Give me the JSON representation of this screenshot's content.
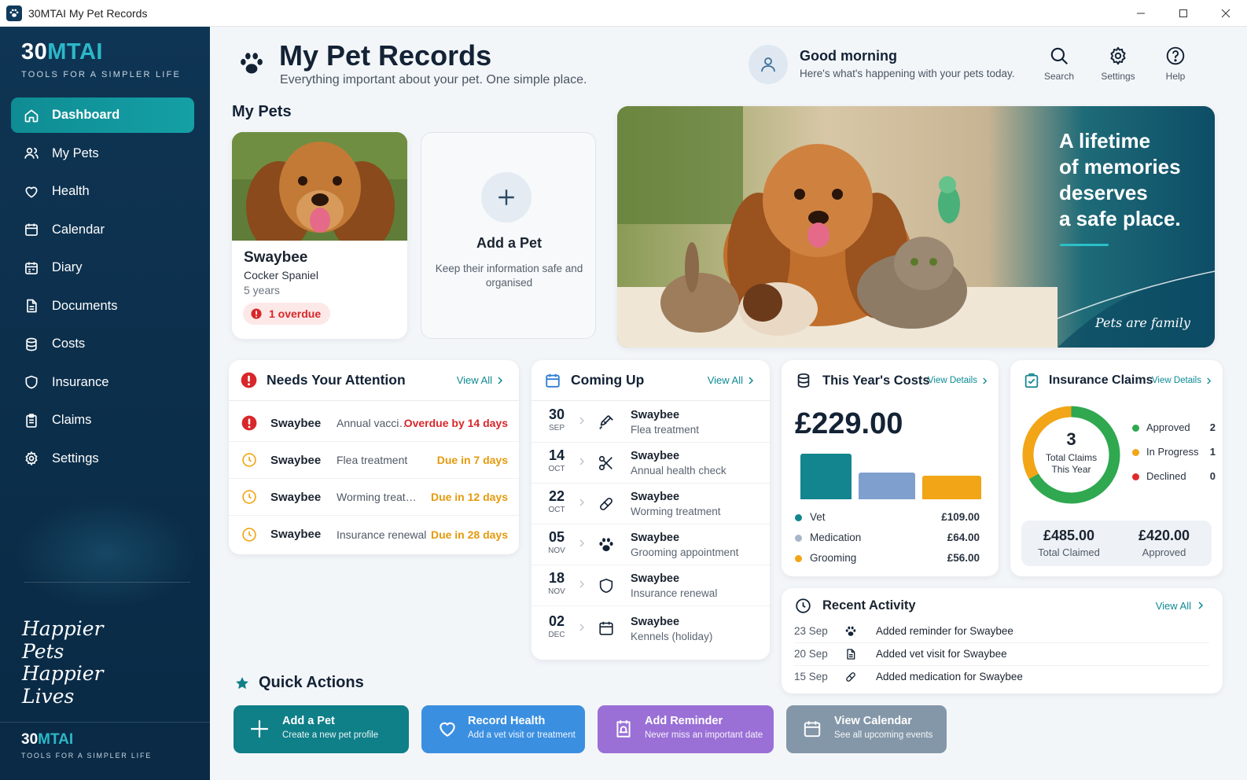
{
  "window": {
    "title": "30MTAI My Pet Records"
  },
  "brand": {
    "logo_a": "30",
    "logo_b": "MTAI",
    "tagline": "TOOLS FOR A SIMPLER LIFE"
  },
  "nav": {
    "items": [
      {
        "label": "Dashboard",
        "icon": "home-icon",
        "active": true
      },
      {
        "label": "My Pets",
        "icon": "users-icon"
      },
      {
        "label": "Health",
        "icon": "heart-icon"
      },
      {
        "label": "Calendar",
        "icon": "calendar-icon"
      },
      {
        "label": "Diary",
        "icon": "diary-icon"
      },
      {
        "label": "Documents",
        "icon": "document-icon"
      },
      {
        "label": "Costs",
        "icon": "coins-icon"
      },
      {
        "label": "Insurance",
        "icon": "shield-icon"
      },
      {
        "label": "Claims",
        "icon": "clipboard-icon"
      },
      {
        "label": "Settings",
        "icon": "gear-icon"
      }
    ]
  },
  "sidebar_script": [
    "Happier",
    "Pets",
    "Happier",
    "Lives"
  ],
  "header": {
    "title": "My Pet Records",
    "subtitle": "Everything important about your pet. One simple place.",
    "greeting": "Good morning",
    "greeting_sub": "Here's what's happening with your pets today.",
    "search": "Search",
    "settings": "Settings",
    "help": "Help"
  },
  "my_pets": {
    "title": "My Pets",
    "pet": {
      "name": "Swaybee",
      "breed": "Cocker Spaniel",
      "age": "5 years",
      "badge": "1 overdue"
    },
    "add": {
      "title": "Add a Pet",
      "subtitle": "Keep their information safe and organised"
    }
  },
  "hero": {
    "lines": [
      "A lifetime",
      "of memories",
      "deserves",
      "a safe place."
    ],
    "script": "Pets are family"
  },
  "attention": {
    "title": "Needs Your Attention",
    "view_all": "View All",
    "rows": [
      {
        "pet": "Swaybee",
        "task": "Annual vacci…",
        "status": "Overdue by 14 days",
        "kind": "overdue"
      },
      {
        "pet": "Swaybee",
        "task": "Flea treatment",
        "status": "Due in 7 days",
        "kind": "due"
      },
      {
        "pet": "Swaybee",
        "task": "Worming treat…",
        "status": "Due in 12 days",
        "kind": "due"
      },
      {
        "pet": "Swaybee",
        "task": "Insurance renewal",
        "status": "Due in 28 days",
        "kind": "due"
      }
    ]
  },
  "coming_up": {
    "title": "Coming Up",
    "view_all": "View All",
    "rows": [
      {
        "day": "30",
        "month": "SEP",
        "pet": "Swaybee",
        "event": "Flea treatment",
        "icon": "syringe-icon"
      },
      {
        "day": "14",
        "month": "OCT",
        "pet": "Swaybee",
        "event": "Annual health check",
        "icon": "scissors-icon"
      },
      {
        "day": "22",
        "month": "OCT",
        "pet": "Swaybee",
        "event": "Worming treatment",
        "icon": "pill-icon"
      },
      {
        "day": "05",
        "month": "NOV",
        "pet": "Swaybee",
        "event": "Grooming appointment",
        "icon": "paw-icon"
      },
      {
        "day": "18",
        "month": "NOV",
        "pet": "Swaybee",
        "event": "Insurance renewal",
        "icon": "shield-icon"
      },
      {
        "day": "02",
        "month": "DEC",
        "pet": "Swaybee",
        "event": "Kennels (holiday)",
        "icon": "calendar-icon"
      }
    ]
  },
  "costs": {
    "title": "This Year's Costs",
    "view_details": "View Details",
    "total": "£229.00",
    "items": [
      {
        "label": "Vet",
        "amount": "£109.00",
        "value": 109,
        "color": "#12858f"
      },
      {
        "label": "Medication",
        "amount": "£64.00",
        "value": 64,
        "color": "#7f9fcf"
      },
      {
        "label": "Grooming",
        "amount": "£56.00",
        "value": 56,
        "color": "#f2a516"
      }
    ]
  },
  "insurance": {
    "title": "Insurance Claims",
    "view_details": "View Details",
    "total": "3",
    "total_label_1": "Total Claims",
    "total_label_2": "This Year",
    "statuses": [
      {
        "label": "Approved",
        "count": "2",
        "value": 2,
        "color": "#2fa84f"
      },
      {
        "label": "In Progress",
        "count": "1",
        "value": 1,
        "color": "#f2a516"
      },
      {
        "label": "Declined",
        "count": "0",
        "value": 0,
        "color": "#e02b2b"
      }
    ],
    "claimed": "£485.00",
    "claimed_label": "Total Claimed",
    "approved": "£420.00",
    "approved_label": "Approved"
  },
  "recent": {
    "title": "Recent Activity",
    "view_all": "View All",
    "rows": [
      {
        "date": "23 Sep",
        "text": "Added reminder for Swaybee",
        "icon": "paw-icon"
      },
      {
        "date": "20 Sep",
        "text": "Added vet visit for Swaybee",
        "icon": "document-icon"
      },
      {
        "date": "15 Sep",
        "text": "Added medication for Swaybee",
        "icon": "pill-icon"
      }
    ]
  },
  "quick_actions": {
    "title": "Quick Actions",
    "items": [
      {
        "title": "Add a Pet",
        "sub": "Create a new pet profile",
        "color": "#0f7f88"
      },
      {
        "title": "Record Health",
        "sub": "Add a vet visit or treatment",
        "color": "#3b8fe0"
      },
      {
        "title": "Add Reminder",
        "sub": "Never miss an important date",
        "color": "#9a6fd6"
      },
      {
        "title": "View Calendar",
        "sub": "See all upcoming events",
        "color": "#8497a8"
      }
    ]
  }
}
